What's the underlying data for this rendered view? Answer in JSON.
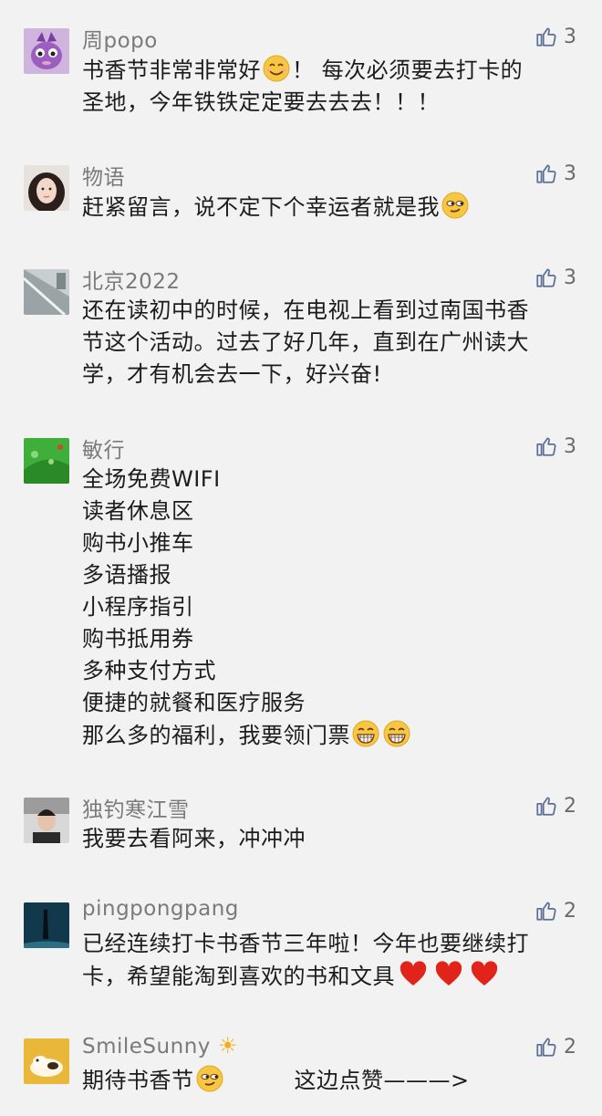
{
  "comments": [
    {
      "user": "周popo",
      "likes": "3",
      "lines": [
        "书香节非常非常好",
        "！ 每次必须要去打卡的",
        "圣地，今年铁铁定定要去去去！！！"
      ]
    },
    {
      "user": "物语",
      "likes": "3",
      "lines": [
        "赶紧留言，说不定下个幸运者就是我"
      ]
    },
    {
      "user": "北京2022",
      "likes": "3",
      "lines": [
        "还在读初中的时候，在电视上看到过南国书香",
        "节这个活动。过去了好几年，直到在广州读大",
        "学，才有机会去一下，好兴奋!"
      ]
    },
    {
      "user": "敏行",
      "likes": "3",
      "lines": [
        "全场免费WIFI",
        "读者休息区",
        "购书小推车",
        "多语播报",
        "小程序指引",
        "购书抵用券",
        "多种支付方式",
        "便捷的就餐和医疗服务",
        "那么多的福利，我要领门票"
      ]
    },
    {
      "user": "独钓寒江雪",
      "likes": "2",
      "lines": [
        "我要去看阿来，冲冲冲"
      ]
    },
    {
      "user": "pingpongpang",
      "likes": "2",
      "lines": [
        "已经连续打卡书香节三年啦！今年也要继续打",
        "卡，希望能淘到喜欢的书和文具"
      ]
    },
    {
      "user": "SmileSunny",
      "likes": "2",
      "lines": [
        "期待书香节",
        "这边点赞———>"
      ]
    }
  ],
  "icons": {
    "like": "thumbs-up-icon",
    "smile": "smile-emoji",
    "smirk": "smirk-emoji",
    "grin": "grin-emoji",
    "heart": "red-heart-emoji",
    "sun": "sun-icon"
  },
  "colors": {
    "background": "#f2f2f2",
    "username": "#7a7a7a",
    "text": "#1c1c1c",
    "like": "#6b6b6b",
    "emoji_face": "#f7c744",
    "heart": "#e2231a"
  }
}
